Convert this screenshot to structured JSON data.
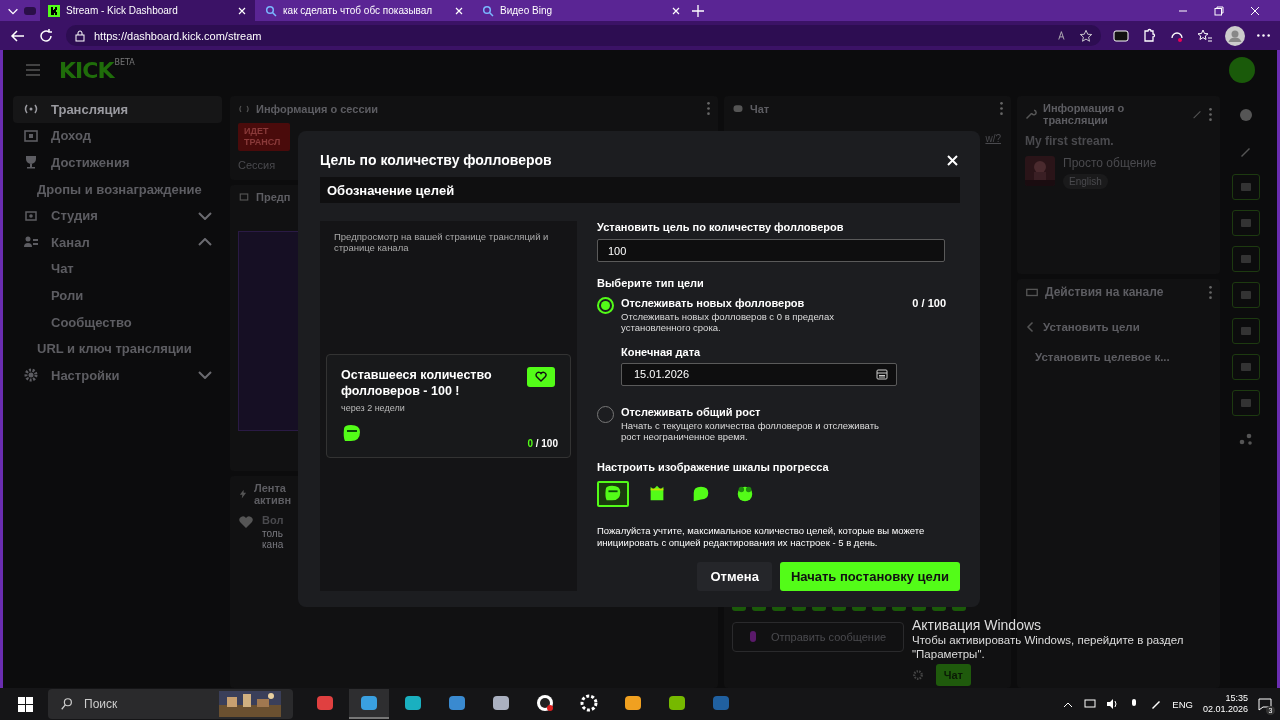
{
  "browser": {
    "tabs": [
      {
        "title": "Stream - Kick Dashboard",
        "selected": true
      },
      {
        "title": "как сделать чтоб обс показывал",
        "selected": false
      },
      {
        "title": "Видео Bing",
        "selected": false
      }
    ],
    "url": "https://dashboard.kick.com/stream"
  },
  "header": {
    "logo": "KICK",
    "logo_badge": "BETA"
  },
  "sidebar": {
    "items": [
      {
        "label": "Трансляция",
        "kind": "main",
        "selected": true
      },
      {
        "label": "Доход",
        "kind": "main",
        "selected": false
      },
      {
        "label": "Достижения",
        "kind": "main",
        "selected": false
      },
      {
        "label": "Дропы и вознаграждение",
        "kind": "plain",
        "selected": false
      },
      {
        "label": "Студия",
        "kind": "main",
        "selected": false,
        "expanded": false
      },
      {
        "label": "Канал",
        "kind": "main",
        "selected": false,
        "expanded": true,
        "children": [
          {
            "label": "Чат",
            "selected": false
          },
          {
            "label": "Роли",
            "selected": false
          },
          {
            "label": "Сообщество",
            "selected": false
          }
        ]
      },
      {
        "label": "URL и ключ трансляции",
        "kind": "plain",
        "selected": false
      },
      {
        "label": "Настройки",
        "kind": "main",
        "selected": false,
        "expanded": false
      }
    ]
  },
  "session_panel": {
    "title": "Информация о сессии",
    "live_badge": "ИДЕТ ТРАНСЛ",
    "session_label": "Сессия",
    "preview_title": "Предп"
  },
  "activity_panel": {
    "title": "Лента активн",
    "item_title": "Вол",
    "item_text": "толь кана"
  },
  "chat": {
    "title": "Чат",
    "link_fragment": "w/?",
    "placeholder": "Отправить сообщение",
    "send_button": "Чат"
  },
  "stream_info": {
    "title": "Информация о трансляции",
    "stream_title": "My first stream.",
    "category": "Просто общение",
    "tag": "English"
  },
  "channel_actions": {
    "title": "Действия на канале",
    "back_label": "Установить цели",
    "item": "Установить целевое к..."
  },
  "modal": {
    "title": "Цель по количеству фолловеров",
    "section": "Обозначение целей",
    "preview": {
      "caption": "Предпросмотр на вашей странице трансляций и странице канала",
      "card_title": "Оставшееся количество фолловеров - 100 !",
      "card_subtitle": "через 2 недели",
      "progress_current": "0",
      "progress_total": "/ 100"
    },
    "goal_label": "Установить цель по количеству фолловеров",
    "goal_value": "100",
    "type_label": "Выберите тип цели",
    "options": [
      {
        "title": "Отслеживать новых фолловеров",
        "description": "Отслеживать новых фолловеров с 0 в пределах установленного срока.",
        "count": "0 / 100",
        "selected": true,
        "date_label": "Конечная дата",
        "date_value": "15.01.2026"
      },
      {
        "title": "Отслеживать общий рост",
        "description": "Начать с текущего количества фолловеров и отслеживать рост неограниченное время.",
        "selected": false
      }
    ],
    "image_label": "Настроить изображение шкалы прогресса",
    "images": [
      {
        "selected": true
      },
      {
        "selected": false
      },
      {
        "selected": false
      },
      {
        "selected": false
      }
    ],
    "note": "Пожалуйста учтите, максимальное количество целей, которые вы можете инициировать с опцией редактирования их настроек - 5 в день.",
    "cancel": "Отмена",
    "submit": "Начать постановку цели"
  },
  "os_notice": {
    "title": "Активация Windows",
    "text": "Чтобы активировать Windows, перейдите в раздел \"Параметры\"."
  },
  "taskbar": {
    "search_placeholder": "Поиск",
    "language": "ENG",
    "time": "15:35",
    "date": "02.01.2026",
    "notifications": "3"
  }
}
